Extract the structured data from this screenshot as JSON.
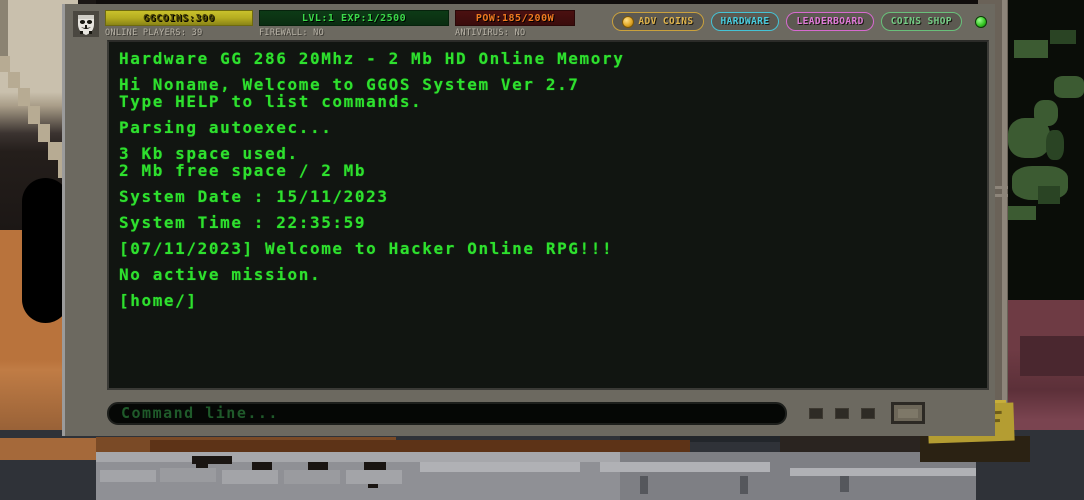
{
  "hud": {
    "avatar_icon": "anonymous-mask-icon",
    "coins": {
      "label": "GGCOINS:300",
      "color": "#b5ad20"
    },
    "exp": {
      "label": "LVL:1 EXP:1/2500",
      "color": "#3bd94a"
    },
    "power": {
      "label": "POW:185/200W",
      "color": "#f07a21"
    },
    "online_players": "ONLINE PLAYERS: 39",
    "firewall": "FIREWALL: NO",
    "antivirus": "ANTIVIRUS: NO",
    "buttons": [
      {
        "label": "ADV COINS",
        "icon": "coin-icon",
        "color": "#e0b44d"
      },
      {
        "label": "HARDWARE",
        "icon": "hardware-icon",
        "color": "#49cde0"
      },
      {
        "label": "LEADERBOARD",
        "icon": "leaderboard-icon",
        "color": "#e07ad8"
      },
      {
        "label": "COINS SHOP",
        "icon": "shop-icon",
        "color": "#74cc85"
      }
    ],
    "online_status_icon": "online-status-dot"
  },
  "terminal": {
    "text_color": "#2ee02e",
    "lines": [
      "Hardware GG 286 20Mhz - 2 Mb HD Online Memory",
      "Hi Noname, Welcome to GGOS System Ver 2.7",
      "Type HELP to list commands.",
      "Parsing autoexec...",
      "3 Kb space used.",
      "2 Mb free space / 2 Mb",
      "System Date : 15/11/2023",
      "System Time : 22:35:59",
      "[07/11/2023] Welcome to Hacker Online RPG!!!",
      "No active mission.",
      "[home/]"
    ]
  },
  "command_bar": {
    "placeholder": "Command line...",
    "value": "",
    "mini_buttons": [
      "mini-button-1",
      "mini-button-2",
      "mini-button-3"
    ],
    "enter_button": "keyboard-toggle-button"
  }
}
